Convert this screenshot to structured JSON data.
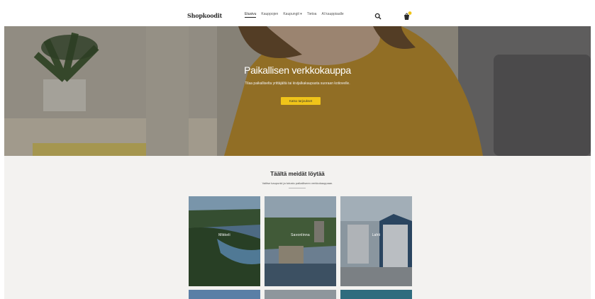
{
  "header": {
    "logo": "Shopkoodit",
    "nav": [
      "Etusivu",
      "Kauppojen",
      "Kaupungit ▾",
      "Tietoa",
      "Al kauppiaalle"
    ]
  },
  "icons": {
    "search": "search-icon",
    "cart": "shopping-bag-icon"
  },
  "hero": {
    "title": "Paikallisen verkkokauppa",
    "subtitle": "Tilaa paikalliselta yrittäjältä tai kivijalkakaupasta suoraan kotiovelle.",
    "button": "Katso tarjoukset"
  },
  "section": {
    "title": "Täältä meidät löytää",
    "subtitle": "Valitse kaupunki ja tutustu paikalliseen verkkokauppaan."
  },
  "cities": [
    {
      "name": "Mikkeli"
    },
    {
      "name": "Savonlinna"
    },
    {
      "name": "Lahti"
    }
  ],
  "colors": {
    "accent": "#f0c419",
    "background": "#f3f2f0",
    "header_bg": "#ffffff"
  }
}
